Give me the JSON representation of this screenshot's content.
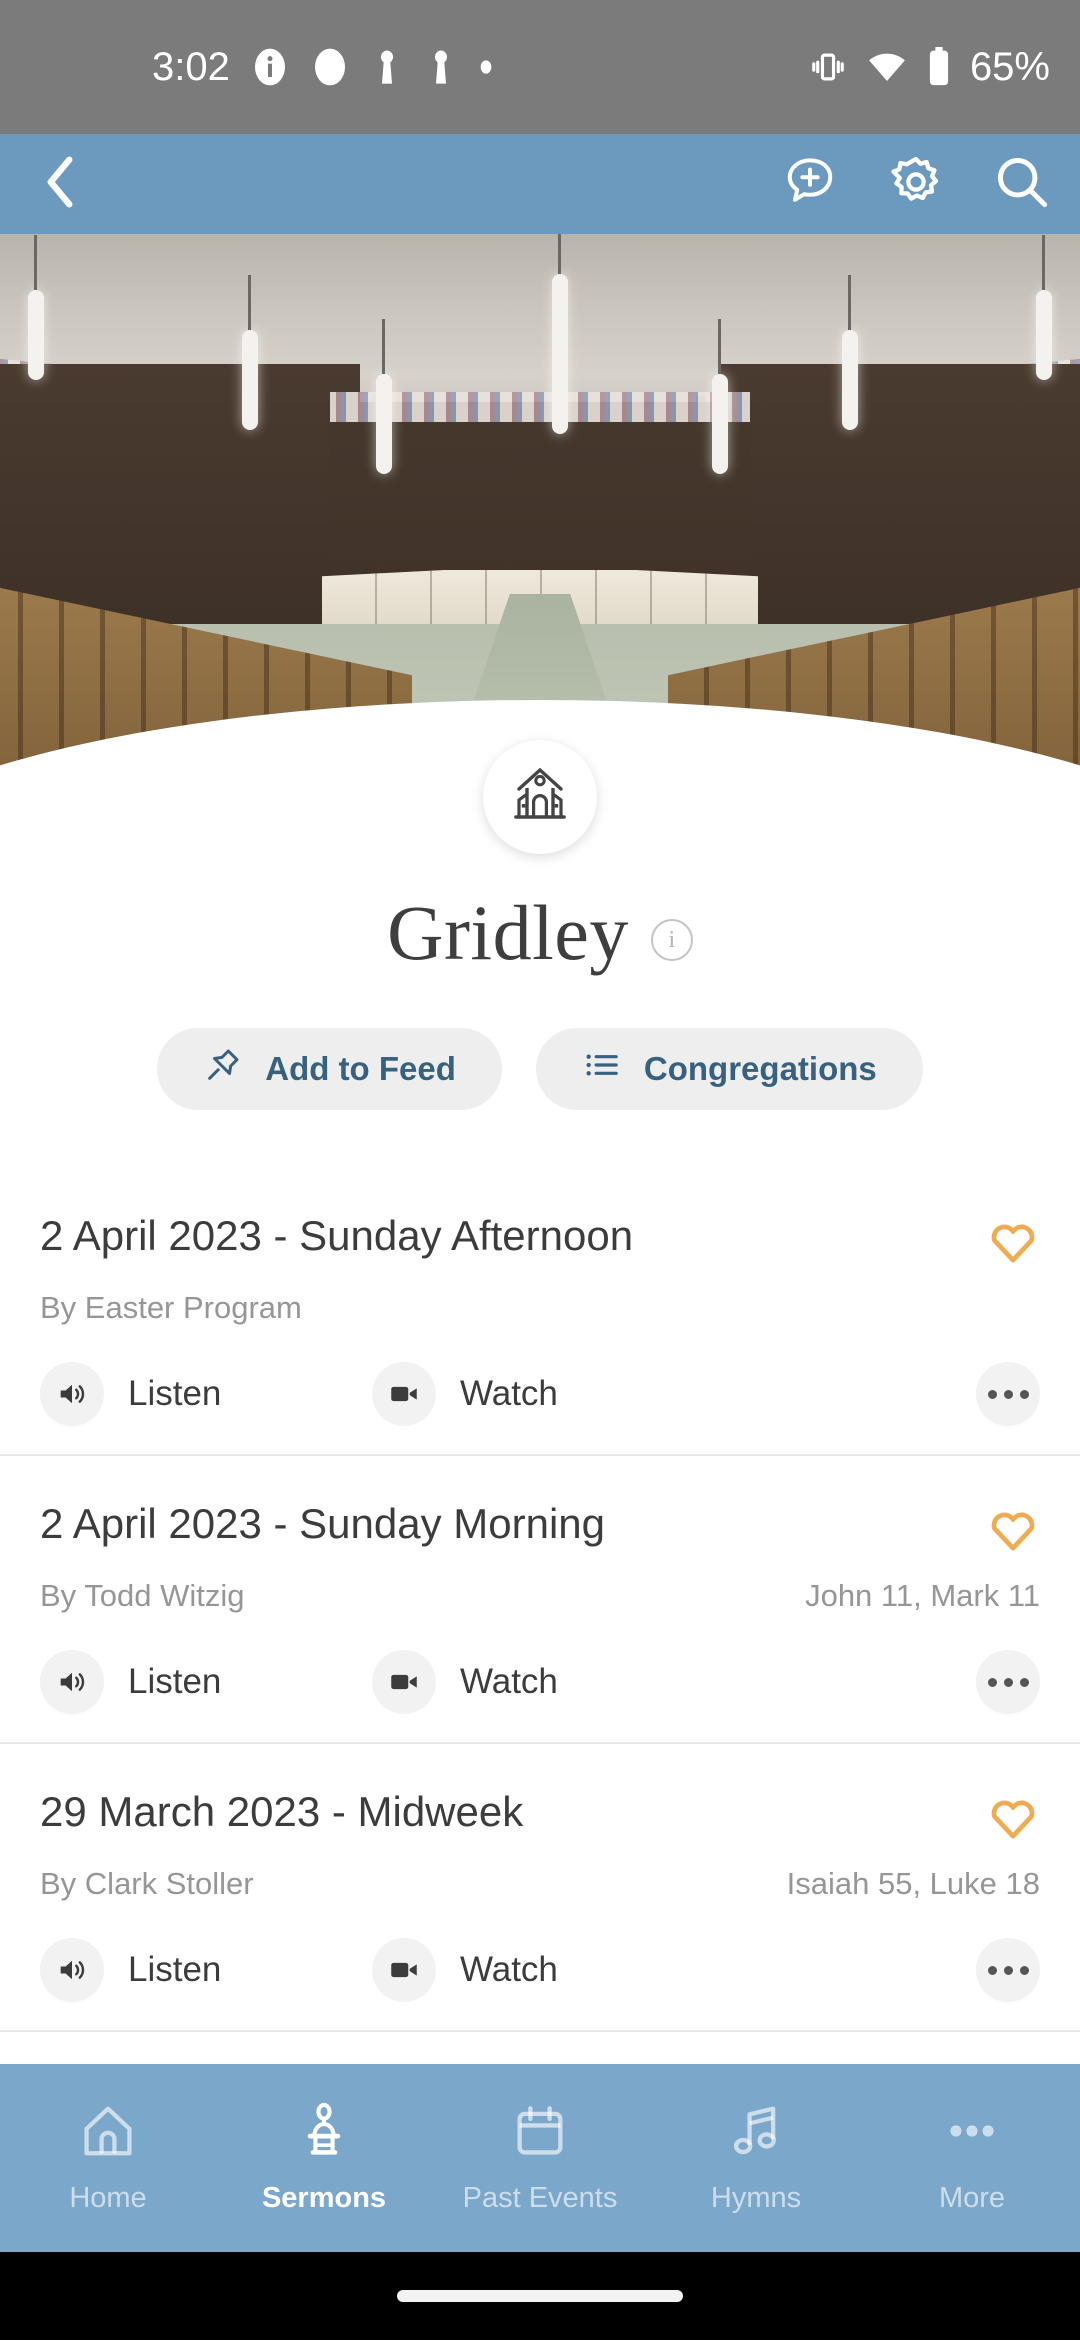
{
  "status_bar": {
    "time": "3:02",
    "battery_percent": "65%",
    "icons_left": [
      "info-icon",
      "circle-icon",
      "keyhole-icon",
      "keyhole-icon",
      "dot-icon"
    ],
    "icons_right": [
      "vibrate-icon",
      "wifi-icon",
      "battery-icon"
    ],
    "background_color": "#7b7b7b"
  },
  "app_header": {
    "back_icon": "chevron-left-icon",
    "actions": [
      "chat-add-icon",
      "gear-icon",
      "search-icon"
    ],
    "background_color": "#6b9abe"
  },
  "hero": {
    "image_description": "church sanctuary interior with wooden pews"
  },
  "profile": {
    "avatar_icon": "church-icon",
    "title": "Gridley",
    "info_icon": "info-circle-icon",
    "chips": [
      {
        "label": "Add to Feed",
        "icon": "pin-icon"
      },
      {
        "label": "Congregations",
        "icon": "list-icon"
      }
    ],
    "chip_text_color": "#37617f"
  },
  "sermons": {
    "listen_label": "Listen",
    "watch_label": "Watch",
    "listen_icon": "speaker-icon",
    "watch_icon": "video-camera-icon",
    "more_icon": "ellipsis-icon",
    "favorite_icon": "heart-outline-icon",
    "favorite_color": "#eeab52",
    "items": [
      {
        "title": "2 April 2023 - Sunday Afternoon",
        "speaker": "By Easter Program",
        "scripture": ""
      },
      {
        "title": "2 April 2023 - Sunday Morning",
        "speaker": "By Todd Witzig",
        "scripture": "John 11, Mark 11"
      },
      {
        "title": "29 March 2023 - Midweek",
        "speaker": "By Clark Stoller",
        "scripture": "Isaiah 55, Luke 18"
      }
    ]
  },
  "bottom_nav": {
    "background_color": "#7ba7ca",
    "active_index": 1,
    "items": [
      {
        "label": "Home",
        "icon": "home-icon"
      },
      {
        "label": "Sermons",
        "icon": "pulpit-icon"
      },
      {
        "label": "Past Events",
        "icon": "calendar-icon"
      },
      {
        "label": "Hymns",
        "icon": "music-note-icon"
      },
      {
        "label": "More",
        "icon": "ellipsis-icon"
      }
    ]
  }
}
